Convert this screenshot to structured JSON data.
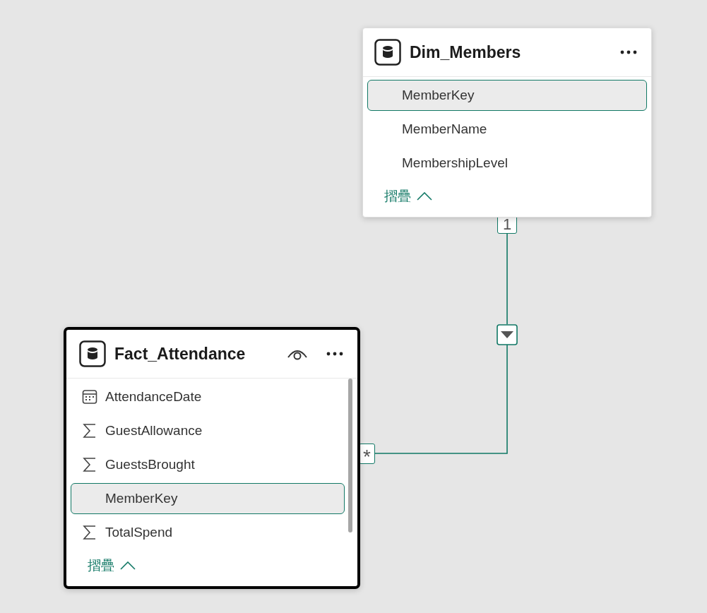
{
  "tables": [
    {
      "name": "Dim_Members",
      "selected": false,
      "eye_icon": false,
      "scrollbar": false,
      "columns": [
        {
          "name": "MemberKey",
          "kind": "plain",
          "selected": true
        },
        {
          "name": "MemberName",
          "kind": "plain",
          "selected": false
        },
        {
          "name": "MembershipLevel",
          "kind": "plain",
          "selected": false
        }
      ],
      "collapse_label": "摺疊"
    },
    {
      "name": "Fact_Attendance",
      "selected": true,
      "eye_icon": true,
      "scrollbar": true,
      "columns": [
        {
          "name": "AttendanceDate",
          "kind": "date",
          "selected": false
        },
        {
          "name": "GuestAllowance",
          "kind": "sum",
          "selected": false
        },
        {
          "name": "GuestsBrought",
          "kind": "sum",
          "selected": false
        },
        {
          "name": "MemberKey",
          "kind": "plain",
          "selected": true
        },
        {
          "name": "TotalSpend",
          "kind": "sum",
          "selected": false
        }
      ],
      "collapse_label": "摺疊"
    }
  ],
  "relationship": {
    "one_side": "1",
    "many_side": "*",
    "bidirectional": false
  }
}
